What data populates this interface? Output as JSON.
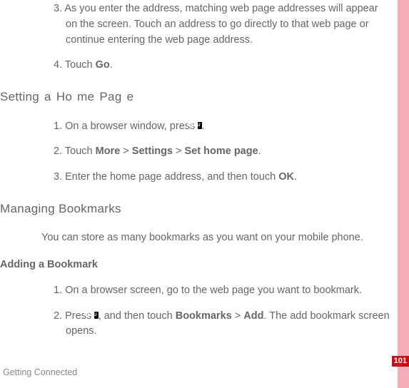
{
  "items": {
    "i3_num": "3.",
    "i3_text": "As you enter the address, matching web page addresses will appear on the screen. Touch an address to go directly to that web page or continue entering the web page address.",
    "i4_num": "4.",
    "i4_prefix": "Touch ",
    "i4_bold": "Go",
    "i4_suffix": "."
  },
  "heading1": "Setting a  Ho me Pag e",
  "section1": {
    "s1_num": "1.",
    "s1_prefix": "On a browser window, press ",
    "s1_icon": "MENU",
    "s1_suffix": ".",
    "s2_num": "2.",
    "s2_prefix": "Touch ",
    "s2_b1": "More",
    "s2_gt1": " > ",
    "s2_b2": "Settings",
    "s2_gt2": " > ",
    "s2_b3": "Set home page",
    "s2_suffix": ".",
    "s3_num": "3.",
    "s3_prefix": "Enter the home page address, and then touch ",
    "s3_bold": "OK",
    "s3_suffix": "."
  },
  "heading2": "Managing Bookmarks",
  "body1": "You can store as many bookmarks as you want on your mobile phone.",
  "subheading": "Adding a Bookmark",
  "section2": {
    "a1_num": "1.",
    "a1_text": "On a browser screen, go to the web page you want to bookmark.",
    "a2_num": "2.",
    "a2_prefix": "Press ",
    "a2_icon": "MENU",
    "a2_mid": ", and then touch ",
    "a2_b1": "Bookmarks",
    "a2_gt": " > ",
    "a2_b2": "Add",
    "a2_suffix": ". The add bookmark screen opens."
  },
  "page_number": "101",
  "footer": "Getting Connected"
}
